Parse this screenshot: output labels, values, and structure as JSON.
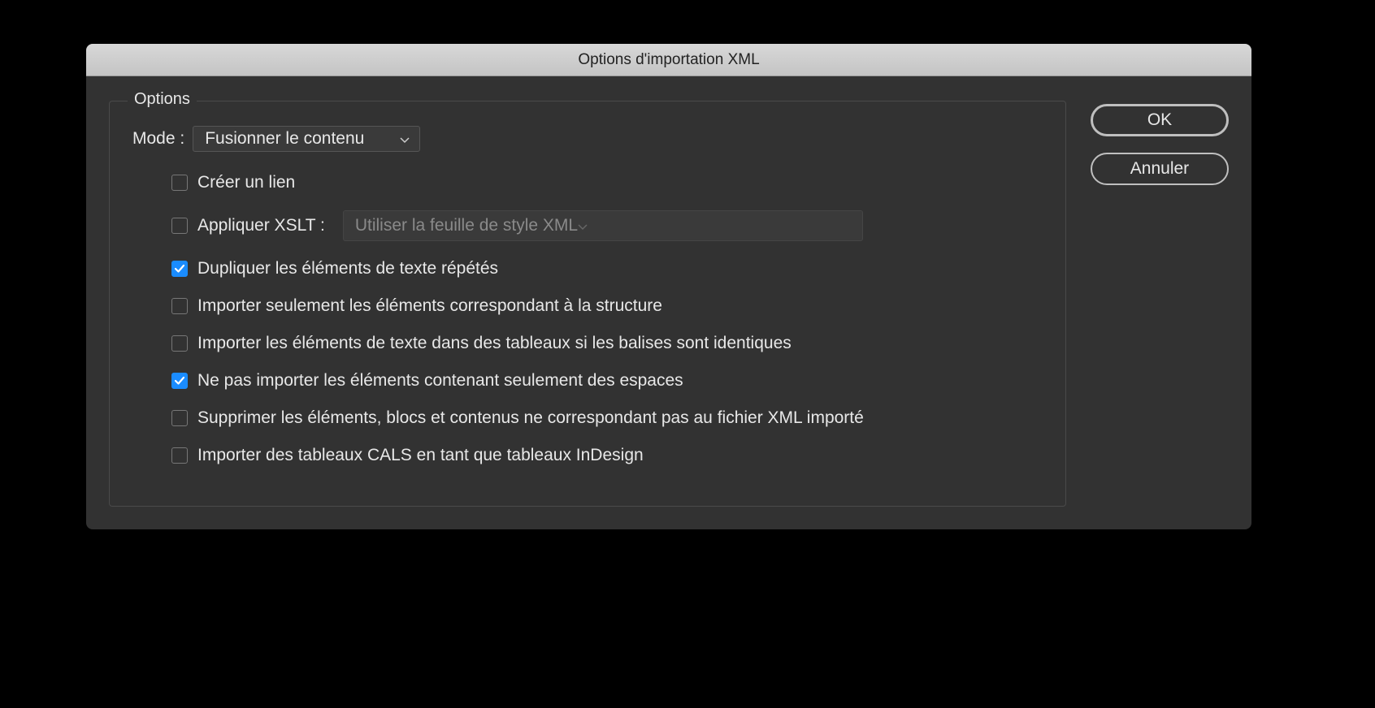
{
  "dialog": {
    "title": "Options d'importation XML"
  },
  "panel": {
    "legend": "Options",
    "mode_label": "Mode :",
    "mode_value": "Fusionner le contenu"
  },
  "options": {
    "create_link": "Créer un lien",
    "apply_xslt": "Appliquer XSLT :",
    "xslt_value": "Utiliser la feuille de style XML",
    "duplicate_repeated": "Dupliquer les éléments de texte répétés",
    "import_matching_structure": "Importer seulement les éléments correspondant à la structure",
    "import_into_tables": "Importer les éléments de texte dans des tableaux si les balises sont identiques",
    "no_whitespace_only": "Ne pas importer les éléments contenant seulement des espaces",
    "delete_unmatched": "Supprimer les éléments, blocs et contenus ne correspondant pas au fichier XML importé",
    "import_cals_tables": "Importer des tableaux CALS en tant que tableaux InDesign"
  },
  "buttons": {
    "ok": "OK",
    "cancel": "Annuler"
  }
}
